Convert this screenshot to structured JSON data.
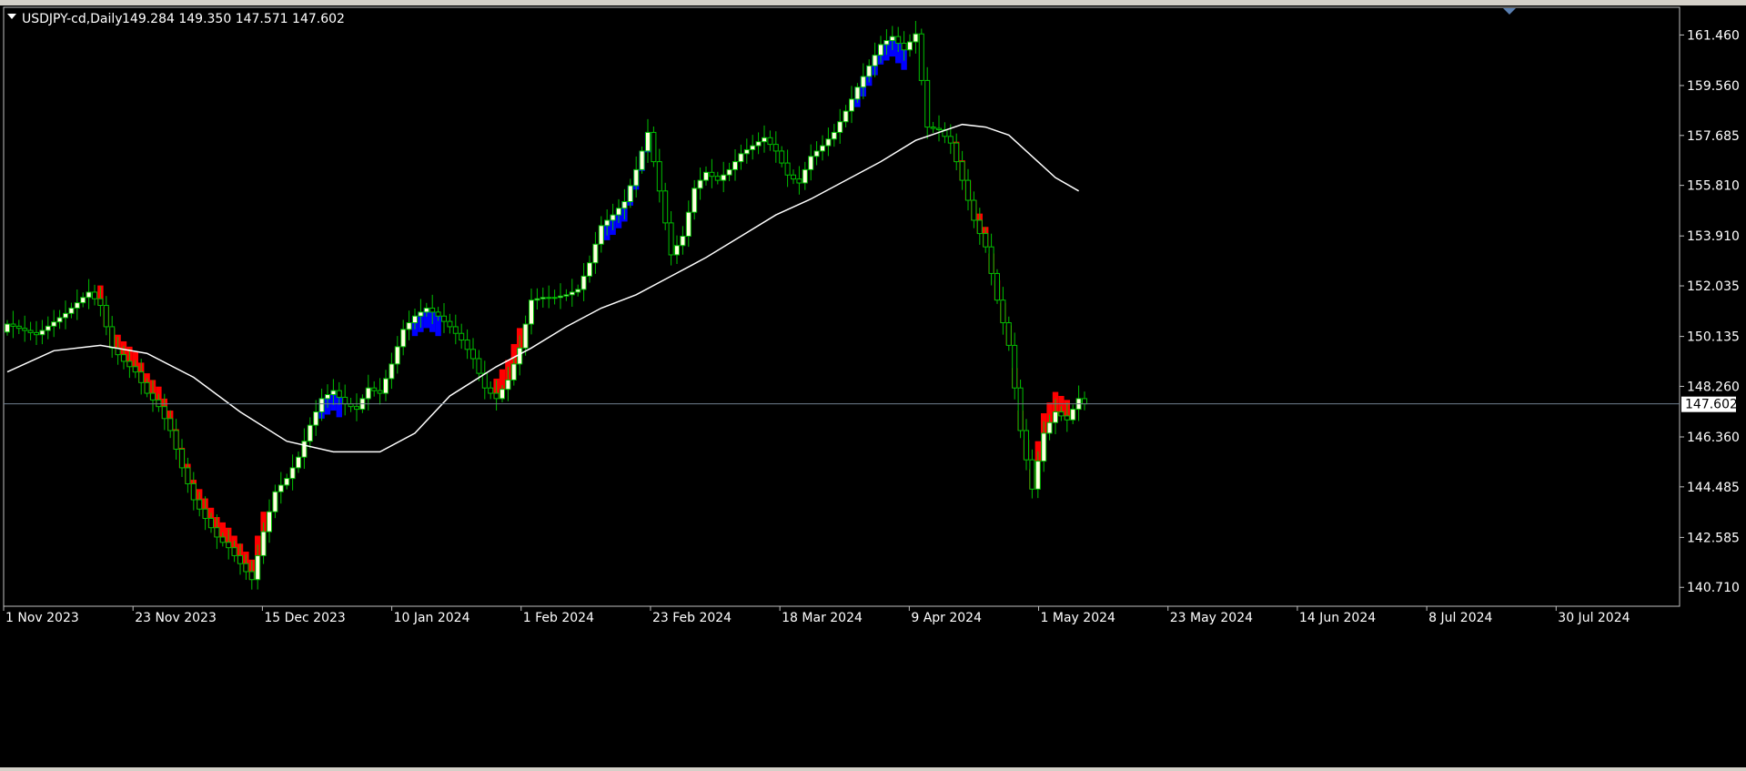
{
  "header": {
    "symbol_timeframe": "USDJPY-cd,Daily",
    "ohlc": "149.284 149.350 147.571 147.602"
  },
  "current_price_label": "147.602",
  "colors": {
    "background": "#000000",
    "frame": "#c0c0c0",
    "bull_candle_outline": "#00c000",
    "bull_candle_body": "#ffffe0",
    "wick": "#00c000",
    "uptrend_band": "#0000ff",
    "downtrend_band": "#ff0000",
    "moving_average": "#ffffff",
    "price_line": "#6f7f8f"
  },
  "chart_data": {
    "type": "candlestick",
    "title": "USDJPY-cd,Daily",
    "price_axis_ticks": [
      "161.460",
      "159.560",
      "157.685",
      "155.810",
      "153.910",
      "152.035",
      "150.135",
      "148.260",
      "146.360",
      "144.485",
      "142.585",
      "140.710"
    ],
    "date_axis_ticks": [
      "1 Nov 2023",
      "23 Nov 2023",
      "15 Dec 2023",
      "10 Jan 2024",
      "1 Feb 2024",
      "23 Feb 2024",
      "18 Mar 2024",
      "9 Apr 2024",
      "1 May 2024",
      "23 May 2024",
      "14 Jun 2024",
      "8 Jul 2024",
      "30 Jul 2024"
    ],
    "ylim": [
      140.0,
      162.5
    ],
    "current_price": 147.602,
    "close_path": [
      [
        0,
        150.6
      ],
      [
        5,
        150.2
      ],
      [
        10,
        151.0
      ],
      [
        14,
        151.8
      ],
      [
        16,
        151.3
      ],
      [
        18,
        149.7
      ],
      [
        20,
        149.2
      ],
      [
        22,
        148.8
      ],
      [
        24,
        148.0
      ],
      [
        26,
        147.5
      ],
      [
        28,
        146.6
      ],
      [
        30,
        145.2
      ],
      [
        32,
        144.0
      ],
      [
        34,
        143.3
      ],
      [
        36,
        142.6
      ],
      [
        38,
        142.2
      ],
      [
        40,
        141.6
      ],
      [
        42,
        141.0
      ],
      [
        44,
        142.8
      ],
      [
        46,
        144.3
      ],
      [
        48,
        144.8
      ],
      [
        50,
        145.6
      ],
      [
        52,
        146.8
      ],
      [
        54,
        147.8
      ],
      [
        56,
        148.1
      ],
      [
        58,
        147.6
      ],
      [
        60,
        147.4
      ],
      [
        62,
        148.2
      ],
      [
        64,
        148.0
      ],
      [
        66,
        149.1
      ],
      [
        68,
        150.4
      ],
      [
        70,
        150.9
      ],
      [
        72,
        151.2
      ],
      [
        74,
        150.9
      ],
      [
        76,
        150.5
      ],
      [
        78,
        150.0
      ],
      [
        80,
        149.3
      ],
      [
        82,
        148.2
      ],
      [
        84,
        147.8
      ],
      [
        86,
        148.5
      ],
      [
        88,
        149.7
      ],
      [
        90,
        151.5
      ],
      [
        92,
        151.6
      ],
      [
        94,
        151.6
      ],
      [
        96,
        151.7
      ],
      [
        98,
        151.9
      ],
      [
        100,
        152.9
      ],
      [
        102,
        154.3
      ],
      [
        104,
        154.7
      ],
      [
        106,
        155.2
      ],
      [
        108,
        156.4
      ],
      [
        110,
        157.8
      ],
      [
        112,
        155.6
      ],
      [
        114,
        153.2
      ],
      [
        116,
        153.9
      ],
      [
        118,
        155.7
      ],
      [
        120,
        156.3
      ],
      [
        122,
        156.0
      ],
      [
        124,
        156.4
      ],
      [
        126,
        157.0
      ],
      [
        128,
        157.3
      ],
      [
        130,
        157.6
      ],
      [
        132,
        157.1
      ],
      [
        134,
        156.2
      ],
      [
        136,
        155.9
      ],
      [
        138,
        156.9
      ],
      [
        140,
        157.3
      ],
      [
        142,
        157.8
      ],
      [
        144,
        158.6
      ],
      [
        146,
        159.5
      ],
      [
        148,
        160.3
      ],
      [
        150,
        161.1
      ],
      [
        152,
        161.4
      ],
      [
        154,
        160.9
      ],
      [
        156,
        161.5
      ],
      [
        158,
        158.0
      ],
      [
        160,
        157.9
      ],
      [
        162,
        157.4
      ],
      [
        164,
        156.0
      ],
      [
        166,
        154.5
      ],
      [
        168,
        153.5
      ],
      [
        170,
        151.5
      ],
      [
        172,
        149.8
      ],
      [
        174,
        146.6
      ],
      [
        176,
        144.4
      ],
      [
        178,
        146.5
      ],
      [
        180,
        147.3
      ],
      [
        182,
        147.0
      ],
      [
        184,
        147.8
      ],
      [
        185,
        147.602
      ]
    ],
    "moving_average": [
      [
        0,
        148.8
      ],
      [
        8,
        149.6
      ],
      [
        16,
        149.8
      ],
      [
        24,
        149.5
      ],
      [
        32,
        148.6
      ],
      [
        40,
        147.3
      ],
      [
        48,
        146.2
      ],
      [
        56,
        145.8
      ],
      [
        64,
        145.8
      ],
      [
        70,
        146.5
      ],
      [
        76,
        147.9
      ],
      [
        84,
        149.0
      ],
      [
        90,
        149.7
      ],
      [
        96,
        150.5
      ],
      [
        102,
        151.2
      ],
      [
        108,
        151.7
      ],
      [
        114,
        152.4
      ],
      [
        120,
        153.1
      ],
      [
        126,
        153.9
      ],
      [
        132,
        154.7
      ],
      [
        138,
        155.3
      ],
      [
        144,
        156.0
      ],
      [
        150,
        156.7
      ],
      [
        156,
        157.5
      ],
      [
        160,
        157.8
      ],
      [
        164,
        158.1
      ],
      [
        168,
        158.0
      ],
      [
        172,
        157.7
      ],
      [
        176,
        156.9
      ],
      [
        180,
        156.1
      ],
      [
        184,
        155.6
      ]
    ],
    "signal_bands": [
      {
        "trend": "down",
        "from": 16,
        "to": 44
      },
      {
        "trend": "up",
        "from": 54,
        "to": 57
      },
      {
        "trend": "up",
        "from": 70,
        "to": 74
      },
      {
        "trend": "down",
        "from": 84,
        "to": 88
      },
      {
        "trend": "up",
        "from": 103,
        "to": 110
      },
      {
        "trend": "up",
        "from": 146,
        "to": 154
      },
      {
        "trend": "down",
        "from": 163,
        "to": 182
      }
    ]
  }
}
